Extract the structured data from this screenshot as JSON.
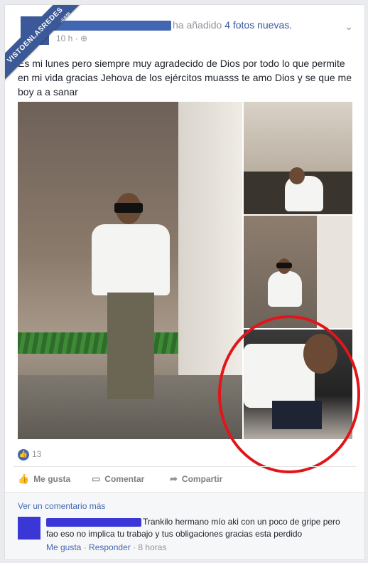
{
  "watermark": {
    "text": "VISTOENLASREDES",
    "suffix": ".com"
  },
  "post": {
    "action": "ha añadido",
    "photo_count": "4 fotos nuevas.",
    "time": "10 h",
    "privacy_icon": "globe-icon",
    "menu_icon": "chevron-down-icon",
    "text": "Es mi lunes pero siempre muy agradecido de Dios por todo lo que permite en mi vida gracias Jehova de los ejércitos muasss te amo Dios y se que me boy a a sanar"
  },
  "reactions": {
    "count": "13",
    "icon": "like-icon"
  },
  "actions": {
    "like": "Me gusta",
    "comment": "Comentar",
    "share": "Compartir"
  },
  "comments": {
    "view_more": "Ver un comentario más",
    "items": [
      {
        "text": "Trankilo hermano mío aki con un poco de gripe pero fao eso no implica tu trabajo y tus obligaciones gracias esta perdido",
        "like": "Me gusta",
        "reply": "Responder",
        "time": "8 horas"
      }
    ]
  },
  "colors": {
    "brand": "#3b5998",
    "link": "#4267b2",
    "highlight": "#e0161a"
  }
}
